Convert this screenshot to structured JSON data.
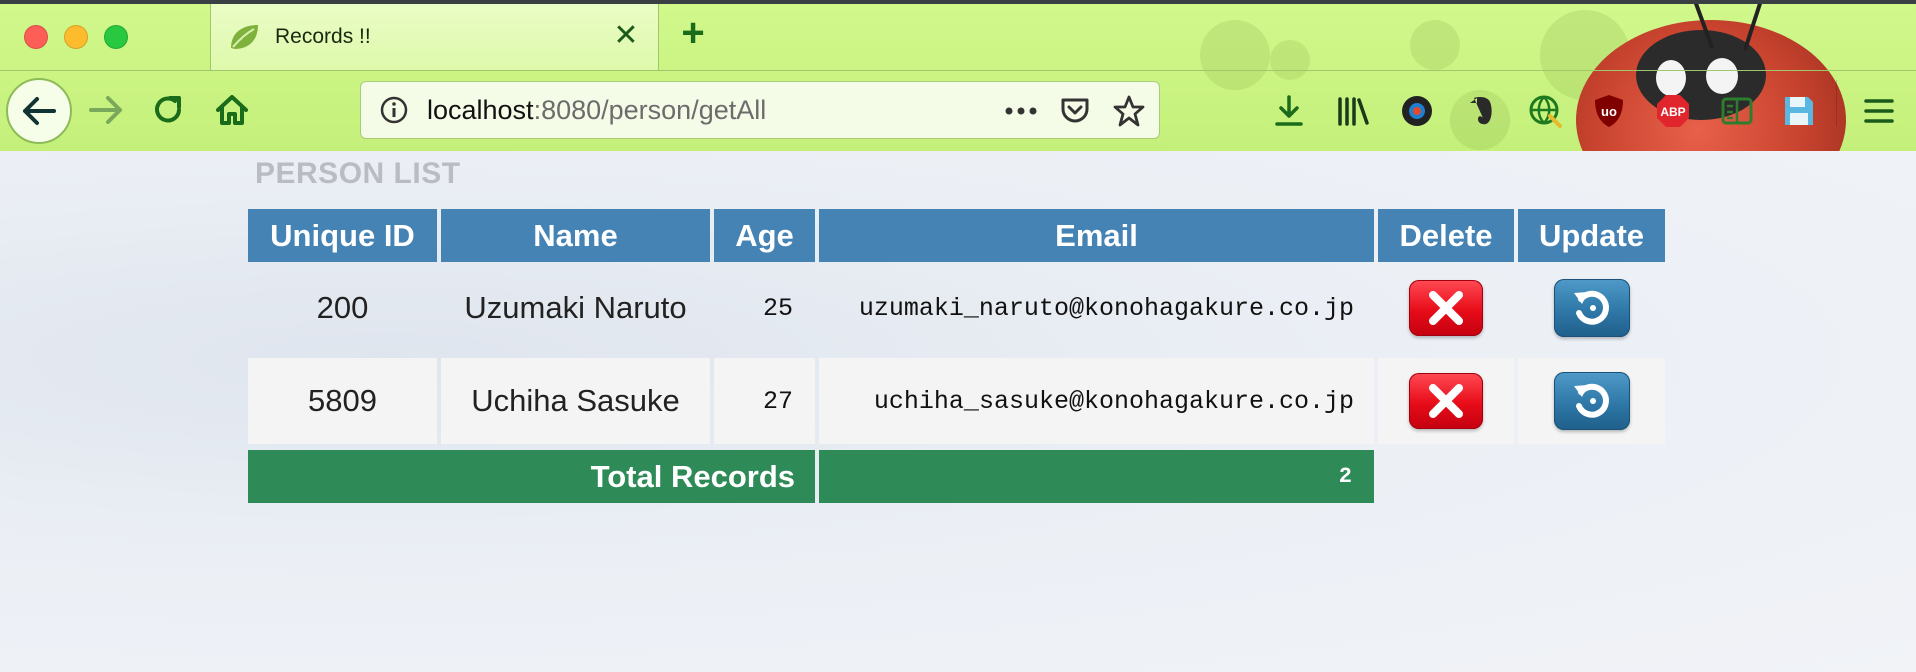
{
  "browser": {
    "tab_title": "Records !!",
    "url_host": "localhost",
    "url_path": ":8080/person/getAll"
  },
  "page": {
    "heading": "PERSON LIST",
    "columns": [
      "Unique ID",
      "Name",
      "Age",
      "Email",
      "Delete",
      "Update"
    ],
    "rows": [
      {
        "id": "200",
        "name": "Uzumaki Naruto",
        "age": "25",
        "email": "uzumaki_naruto@konohagakure.co.jp"
      },
      {
        "id": "5809",
        "name": "Uchiha Sasuke",
        "age": "27",
        "email": "uchiha_sasuke@konohagakure.co.jp"
      }
    ],
    "total_label": "Total Records",
    "total_value": "2"
  },
  "colors": {
    "header_bg": "#4583b5",
    "total_bg": "#2e8b57",
    "toolbar_bg": "#d2f88c",
    "delete_button": "#e70c18",
    "update_button": "#2f78a8"
  },
  "icons": [
    "back-arrow-icon",
    "forward-arrow-icon",
    "reload-icon",
    "home-icon",
    "info-icon",
    "more-actions-icon",
    "pocket-icon",
    "bookmark-star-icon",
    "download-icon",
    "library-icon",
    "extension-icon",
    "evernote-icon",
    "globe-extension-icon",
    "ublock-icon",
    "adblock-plus-icon",
    "reader-icon",
    "save-icon",
    "menu-icon",
    "delete-x-icon",
    "update-refresh-icon"
  ]
}
